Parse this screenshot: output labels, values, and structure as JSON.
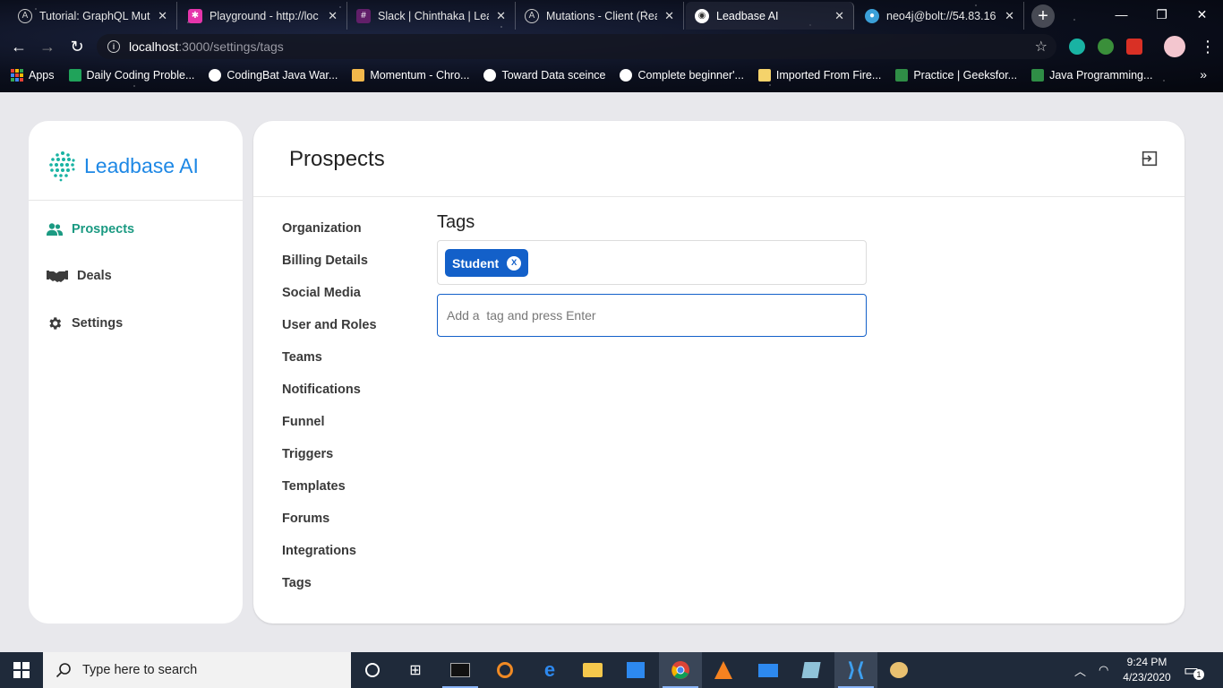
{
  "browser": {
    "tabs": [
      {
        "title": "Tutorial: GraphQL Muta",
        "icon": "apollo-icon"
      },
      {
        "title": "Playground - http://loc",
        "icon": "graphql-icon"
      },
      {
        "title": "Slack | Chinthaka | Lea",
        "icon": "slack-icon"
      },
      {
        "title": "Mutations - Client (Rea",
        "icon": "apollo-icon"
      },
      {
        "title": "Leadbase AI",
        "icon": "globe-icon",
        "active": true
      },
      {
        "title": "neo4j@bolt://54.83.16",
        "icon": "neo4j-icon"
      }
    ],
    "new_tab": "+",
    "url_host": "localhost",
    "url_path": ":3000/settings/tags",
    "bookmarks": [
      {
        "label": "Apps",
        "icon": "apps-grid-icon",
        "color": "#e94235"
      },
      {
        "label": "Daily Coding Proble...",
        "icon": "bookmark-dcp-icon",
        "color": "#20a35a"
      },
      {
        "label": "CodingBat Java War...",
        "icon": "globe-icon",
        "color": "#ffffff"
      },
      {
        "label": "Momentum - Chro...",
        "icon": "momentum-icon",
        "color": "#f2b84b"
      },
      {
        "label": "Toward Data sceince",
        "icon": "globe-icon",
        "color": "#ffffff"
      },
      {
        "label": "Complete beginner'...",
        "icon": "globe-icon",
        "color": "#ffffff"
      },
      {
        "label": "Imported From Fire...",
        "icon": "folder-icon",
        "color": "#f5d36b"
      },
      {
        "label": "Practice | Geeksfor...",
        "icon": "geeksforgeeks-icon",
        "color": "#2f8d46"
      },
      {
        "label": "Java Programming...",
        "icon": "geeksforgeeks-icon",
        "color": "#2f8d46"
      }
    ]
  },
  "app": {
    "brand": "Leadbase AI",
    "brand_color": "#1e88e5",
    "accent_color": "#1b9a82",
    "nav": [
      {
        "label": "Prospects",
        "icon": "users-icon",
        "active": true
      },
      {
        "label": "Deals",
        "icon": "handshake-icon"
      },
      {
        "label": "Settings",
        "icon": "gear-icon"
      }
    ],
    "page_title": "Prospects",
    "settings_menu": [
      "Organization",
      "Billing Details",
      "Social Media",
      "User and Roles",
      "Teams",
      "Notifications",
      "Funnel",
      "Triggers",
      "Templates",
      "Forums",
      "Integrations",
      "Tags"
    ],
    "tags": {
      "heading": "Tags",
      "chips": [
        {
          "label": "Student",
          "remove": "X"
        }
      ],
      "chip_color": "#1360c9",
      "input_placeholder": "Add a  tag and press Enter",
      "input_value": ""
    }
  },
  "taskbar": {
    "search_placeholder": "Type here to search",
    "time": "9:24 PM",
    "date": "4/23/2020",
    "notification_count": "1"
  }
}
